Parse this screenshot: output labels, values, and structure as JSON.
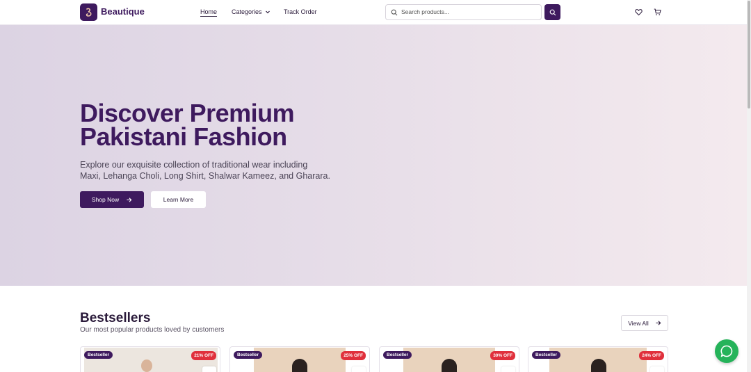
{
  "brand": {
    "name": "Beautique"
  },
  "nav": {
    "home": "Home",
    "categories": "Categories",
    "track_order": "Track Order"
  },
  "search": {
    "placeholder": "Search products..."
  },
  "hero": {
    "title": "Discover Premium Pakistani Fashion",
    "description": "Explore our exquisite collection of traditional wear including Maxi, Lehanga Choli, Long Shirt, Shalwar Kameez, and Gharara.",
    "shop_now": "Shop Now",
    "learn_more": "Learn More"
  },
  "bestsellers": {
    "title": "Bestsellers",
    "subtitle": "Our most popular products loved by customers",
    "view_all": "View All",
    "cards": [
      {
        "badge": "Bestseller",
        "discount": "21% OFF"
      },
      {
        "badge": "Bestseller",
        "discount": "25% OFF"
      },
      {
        "badge": "Bestseller",
        "discount": "30% OFF"
      },
      {
        "badge": "Bestseller",
        "discount": "24% OFF"
      }
    ]
  },
  "colors": {
    "primary": "#3e1a5e",
    "discount": "#e0303c",
    "chat": "#25b35a"
  },
  "icons": [
    "logo-icon",
    "chevron-down-icon",
    "search-icon",
    "heart-icon",
    "cart-icon",
    "arrow-right-icon",
    "chat-icon"
  ]
}
